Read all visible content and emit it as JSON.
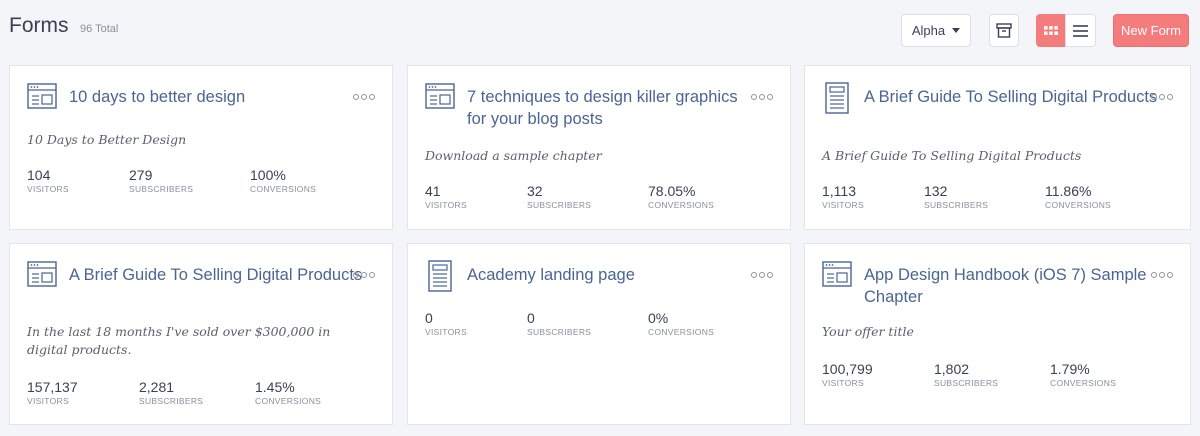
{
  "header": {
    "title": "Forms",
    "total": "96 Total",
    "sort_label": "Alpha",
    "new_button": "New Form"
  },
  "stat_labels": {
    "visitors": "VISITORS",
    "subscribers": "SUBSCRIBERS",
    "conversions": "CONVERSIONS"
  },
  "cards": [
    {
      "title": "10 days to better design",
      "icon": "form-window-icon",
      "description": "10 Days to Better Design",
      "visitors": "104",
      "subscribers": "279",
      "conversions": "100%"
    },
    {
      "title": "7 techniques to design killer graphics for your blog posts",
      "icon": "form-window-icon",
      "description": "Download a sample chapter",
      "visitors": "41",
      "subscribers": "32",
      "conversions": "78.05%"
    },
    {
      "title": "A Brief Guide To Selling Digital Products",
      "icon": "landing-page-icon",
      "description": "A Brief Guide To Selling Digital Products",
      "visitors": "1,113",
      "subscribers": "132",
      "conversions": "11.86%"
    },
    {
      "title": "A Brief Guide To Selling Digital Products",
      "icon": "form-window-icon",
      "description": "In the last 18 months I've sold over $300,000 in digital products.",
      "visitors": "157,137",
      "subscribers": "2,281",
      "conversions": "1.45%"
    },
    {
      "title": "Academy landing page",
      "icon": "landing-page-icon",
      "description": "",
      "visitors": "0",
      "subscribers": "0",
      "conversions": "0%"
    },
    {
      "title": "App Design Handbook (iOS 7) Sample Chapter",
      "icon": "form-window-icon",
      "description": "Your offer title",
      "visitors": "100,799",
      "subscribers": "1,802",
      "conversions": "1.79%"
    }
  ],
  "colors": {
    "accent": "#f47c7c",
    "title_blue": "#4a6594",
    "background": "#f4f5f8"
  }
}
